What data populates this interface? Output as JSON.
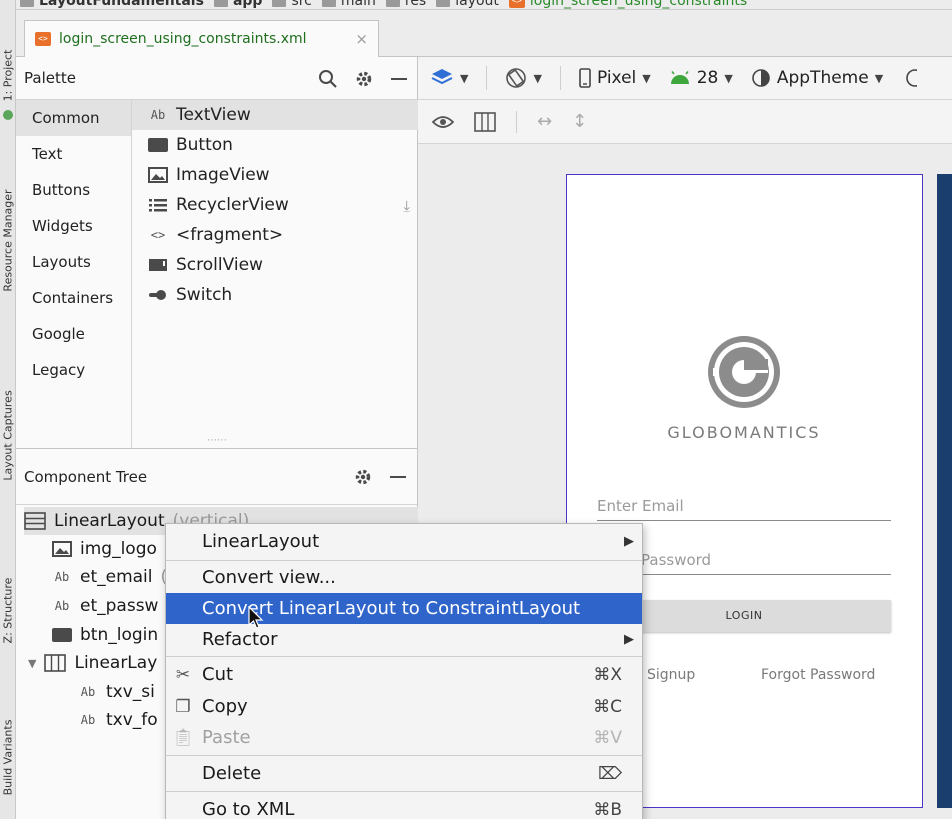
{
  "left_strip": {
    "tabs": [
      "1: Project",
      "Resource Manager",
      "Layout Captures",
      "Z: Structure",
      "Build Variants"
    ]
  },
  "breadcrumbs": [
    {
      "label": "LayoutFundamentals",
      "style": "bold"
    },
    {
      "label": "app",
      "style": "bold"
    },
    {
      "label": "src",
      "style": "normal"
    },
    {
      "label": "main",
      "style": "normal"
    },
    {
      "label": "res",
      "style": "normal"
    },
    {
      "label": "layout",
      "style": "normal"
    },
    {
      "label": "login_screen_using_constraints",
      "style": "green"
    }
  ],
  "editor_tab": {
    "name": "login_screen_using_constraints.xml",
    "icon": "xml-file-icon",
    "close_glyph": "×"
  },
  "palette": {
    "title": "Palette",
    "categories": [
      "Common",
      "Text",
      "Buttons",
      "Widgets",
      "Layouts",
      "Containers",
      "Google",
      "Legacy"
    ],
    "selected_category": "Common",
    "items": [
      {
        "label": "TextView",
        "icon": "Ab",
        "selected": true
      },
      {
        "label": "Button",
        "icon": "button-icon"
      },
      {
        "label": "ImageView",
        "icon": "image-icon"
      },
      {
        "label": "RecyclerView",
        "icon": "list-icon",
        "download": true
      },
      {
        "label": "<fragment>",
        "icon": "code-icon"
      },
      {
        "label": "ScrollView",
        "icon": "scroll-icon"
      },
      {
        "label": "Switch",
        "icon": "switch-icon"
      }
    ]
  },
  "component_tree": {
    "title": "Component Tree",
    "rows": [
      {
        "label": "LinearLayout",
        "hint": "(vertical)",
        "icon": "layout-icon"
      },
      {
        "label": "img_logo",
        "icon": "image-icon"
      },
      {
        "label": "et_email",
        "hint": "(",
        "icon": "Ab"
      },
      {
        "label": "et_passw",
        "icon": "Ab"
      },
      {
        "label": "btn_login",
        "icon": "button-icon"
      },
      {
        "label": "LinearLay",
        "icon": "layout-icon",
        "expanded": true
      },
      {
        "label": "txv_si",
        "icon": "Ab"
      },
      {
        "label": "txv_fo",
        "icon": "Ab"
      }
    ]
  },
  "design_toolbar": {
    "device": "Pixel",
    "api": "28",
    "theme": "AppTheme"
  },
  "preview": {
    "brand": "GLOBOMANTICS",
    "email_hint": "Enter Email",
    "password_hint": "Password",
    "login_label": "LOGIN",
    "signup_label": "Signup",
    "forgot_label": "Forgot Password"
  },
  "context_menu": {
    "items": [
      {
        "label": "LinearLayout",
        "submenu": true
      },
      {
        "label": "Convert view...",
        "shortcut": ""
      },
      {
        "label": "Convert LinearLayout to ConstraintLayout",
        "highlighted": true
      },
      {
        "label": "Refactor",
        "submenu": true
      },
      {
        "label": "Cut",
        "shortcut": "⌘X",
        "icon": "scissors-icon"
      },
      {
        "label": "Copy",
        "shortcut": "⌘C",
        "icon": "copy-icon"
      },
      {
        "label": "Paste",
        "shortcut": "⌘V",
        "icon": "paste-icon",
        "disabled": true
      },
      {
        "label": "Delete",
        "shortcut": "⌦",
        "icon": "delete-icon"
      },
      {
        "label": "Go to XML",
        "shortcut": "⌘B"
      }
    ]
  },
  "colors": {
    "highlight": "#2f65ca",
    "phone_border": "#4b35c6",
    "file_tab_text": "#1f6f1f",
    "blueprint": "#1a3f6e"
  }
}
